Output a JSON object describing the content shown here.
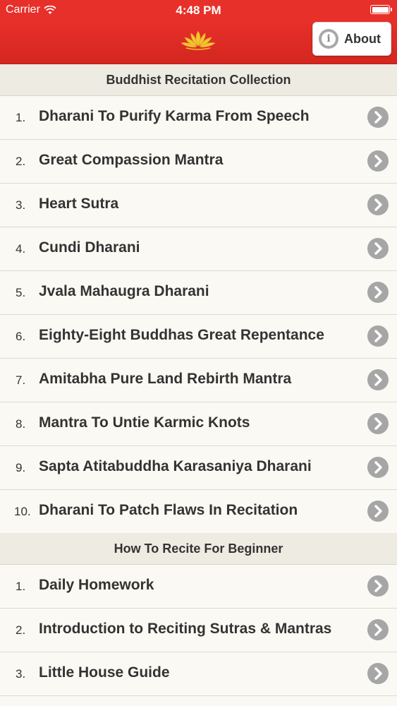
{
  "status_bar": {
    "carrier": "Carrier",
    "time": "4:48 PM"
  },
  "nav": {
    "about_label": "About"
  },
  "colors": {
    "brand_red": "#e8302a",
    "chevron_gray": "#a6a6a6",
    "background": "#faf8f2"
  },
  "sections": [
    {
      "header": "Buddhist Recitation Collection",
      "items": [
        {
          "num": "1.",
          "title": "Dharani To Purify Karma From Speech"
        },
        {
          "num": "2.",
          "title": "Great Compassion Mantra"
        },
        {
          "num": "3.",
          "title": "Heart Sutra"
        },
        {
          "num": "4.",
          "title": "Cundi Dharani"
        },
        {
          "num": "5.",
          "title": "Jvala Mahaugra Dharani"
        },
        {
          "num": "6.",
          "title": "Eighty-Eight Buddhas Great Repentance"
        },
        {
          "num": "7.",
          "title": "Amitabha Pure Land Rebirth Mantra"
        },
        {
          "num": "8.",
          "title": "Mantra To Untie Karmic Knots"
        },
        {
          "num": "9.",
          "title": "Sapta Atitabuddha Karasaniya Dharani"
        },
        {
          "num": "10.",
          "title": "Dharani To Patch Flaws In Recitation"
        }
      ]
    },
    {
      "header": "How To Recite For Beginner",
      "items": [
        {
          "num": "1.",
          "title": "Daily Homework"
        },
        {
          "num": "2.",
          "title": "Introduction to Reciting Sutras & Mantras"
        },
        {
          "num": "3.",
          "title": "Little House Guide"
        }
      ]
    }
  ]
}
